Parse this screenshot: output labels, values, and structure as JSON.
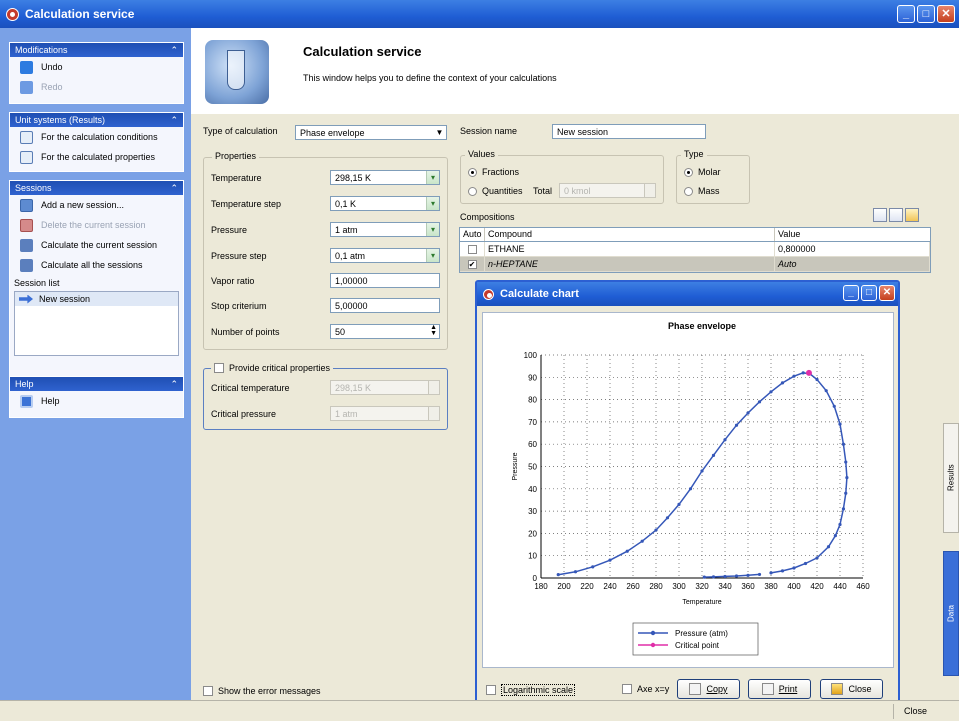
{
  "window": {
    "title": "Calculation service"
  },
  "sidebar": {
    "modifications": {
      "title": "Modifications",
      "undo": "Undo",
      "redo": "Redo"
    },
    "unit_systems": {
      "title": "Unit systems (Results)",
      "calc_conditions": "For the calculation conditions",
      "calc_properties": "For the calculated properties"
    },
    "sessions": {
      "title": "Sessions",
      "add": "Add a new session...",
      "delete": "Delete the current session",
      "calc_current": "Calculate the current session",
      "calc_all": "Calculate all the sessions",
      "list_label": "Session list",
      "items": [
        "New session"
      ]
    },
    "help": {
      "title": "Help",
      "item": "Help"
    }
  },
  "header": {
    "title": "Calculation service",
    "subtitle": "This window helps you to define the context of your calculations"
  },
  "form": {
    "type_label": "Type of calculation",
    "type_value": "Phase envelope",
    "session_name_label": "Session name",
    "session_name_value": "New session",
    "properties": {
      "title": "Properties",
      "rows": [
        {
          "label": "Temperature",
          "value": "298,15 K"
        },
        {
          "label": "Temperature step",
          "value": "0,1 K"
        },
        {
          "label": "Pressure",
          "value": "1 atm"
        },
        {
          "label": "Pressure step",
          "value": "0,1 atm"
        },
        {
          "label": "Vapor ratio",
          "value": "1,00000"
        },
        {
          "label": "Stop criterium",
          "value": "5,00000"
        },
        {
          "label": "Number of points",
          "value": "50"
        }
      ]
    },
    "critical": {
      "title": "Provide critical properties",
      "temp_label": "Critical temperature",
      "temp_value": "298,15 K",
      "press_label": "Critical pressure",
      "press_value": "1 atm"
    },
    "values": {
      "title": "Values",
      "fractions": "Fractions",
      "quantities": "Quantities",
      "total_label": "Total",
      "total_value": "0 kmol"
    },
    "type": {
      "title": "Type",
      "molar": "Molar",
      "mass": "Mass"
    },
    "compositions": {
      "title": "Compositions",
      "headers": [
        "Auto",
        "Compound",
        "Value"
      ],
      "rows": [
        {
          "auto": "",
          "compound": "ETHANE",
          "value": "0,800000"
        },
        {
          "auto": "✔",
          "compound": "n-HEPTANE",
          "value": "Auto"
        }
      ]
    },
    "show_errors": "Show the error messages"
  },
  "chart_window": {
    "title": "Calculate chart",
    "log_scale": "Logarithmic scale",
    "axe": "Axe x=y",
    "copy": "Copy",
    "print": "Print",
    "close": "Close"
  },
  "chart_data": {
    "type": "line",
    "title": "Phase envelope",
    "xlabel": "Temperature",
    "ylabel": "Pressure",
    "xlim": [
      180,
      460
    ],
    "ylim": [
      0,
      100
    ],
    "xticks": [
      180,
      200,
      220,
      240,
      260,
      280,
      300,
      320,
      340,
      360,
      380,
      400,
      420,
      440,
      460
    ],
    "yticks": [
      0,
      10,
      20,
      30,
      40,
      50,
      60,
      70,
      80,
      90,
      100
    ],
    "grid": true,
    "legend": "bottom",
    "series": [
      {
        "name": "Pressure (atm)",
        "color": "#3557b8",
        "x": [
          195,
          210,
          225,
          240,
          255,
          268,
          280,
          290,
          300,
          310,
          320,
          330,
          340,
          350,
          360,
          370,
          380,
          390,
          400,
          408,
          414,
          420,
          428,
          435,
          440,
          443,
          445,
          446,
          445,
          443,
          440,
          436,
          430,
          420,
          410,
          400,
          390,
          380,
          370,
          360,
          350,
          340,
          330,
          322
        ],
        "y": [
          1.5,
          2.8,
          5,
          8,
          12,
          16.5,
          21.5,
          27,
          33,
          40,
          48,
          55,
          62,
          68.5,
          74,
          79,
          83.5,
          87.5,
          90.5,
          92,
          91.5,
          89,
          84,
          77,
          69,
          60,
          52,
          45,
          38,
          31,
          24,
          19,
          14,
          9,
          6.5,
          4.5,
          3.2,
          2.3,
          1.6,
          1.2,
          0.9,
          0.7,
          0.5,
          0.4
        ]
      },
      {
        "name": "Critical point",
        "color": "#e02ea8",
        "x": [
          413
        ],
        "y": [
          92
        ]
      }
    ]
  },
  "side_tabs": {
    "results": "Results",
    "data": "Data"
  },
  "status": {
    "close": "Close"
  }
}
